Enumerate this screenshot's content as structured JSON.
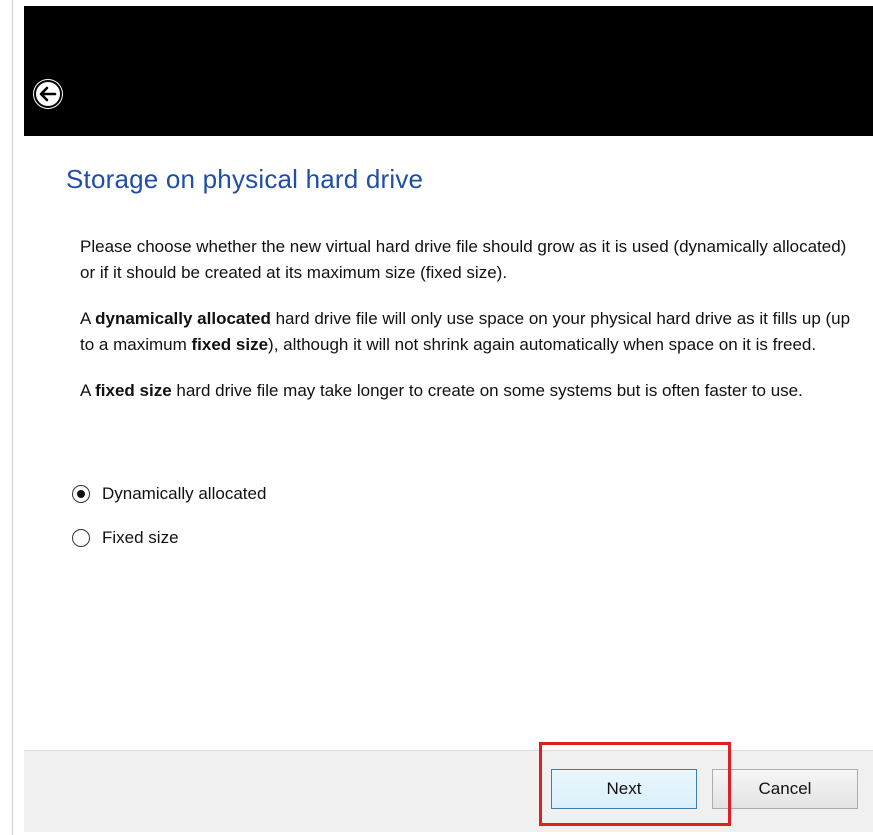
{
  "header": {
    "back_icon": "back-arrow-icon"
  },
  "page": {
    "title": "Storage on physical hard drive",
    "paragraph1": "Please choose whether the new virtual hard drive file should grow as it is used (dynamically allocated) or if it should be created at its maximum size (fixed size).",
    "paragraph2": {
      "prefix": "A ",
      "bold1": "dynamically allocated",
      "middle": " hard drive file will only use space on your physical hard drive as it fills up (up to a maximum ",
      "bold2": "fixed size",
      "suffix": "), although it will not shrink again automatically when space on it is freed."
    },
    "paragraph3": {
      "prefix": "A ",
      "bold": "fixed size",
      "suffix": " hard drive file may take longer to create on some systems but is often faster to use."
    }
  },
  "options": [
    {
      "label": "Dynamically allocated",
      "selected": true
    },
    {
      "label": "Fixed size",
      "selected": false
    }
  ],
  "footer": {
    "next_label": "Next",
    "cancel_label": "Cancel"
  },
  "colors": {
    "title": "#1f4ea8",
    "titlebar": "#000000",
    "highlight": "#e02020"
  }
}
